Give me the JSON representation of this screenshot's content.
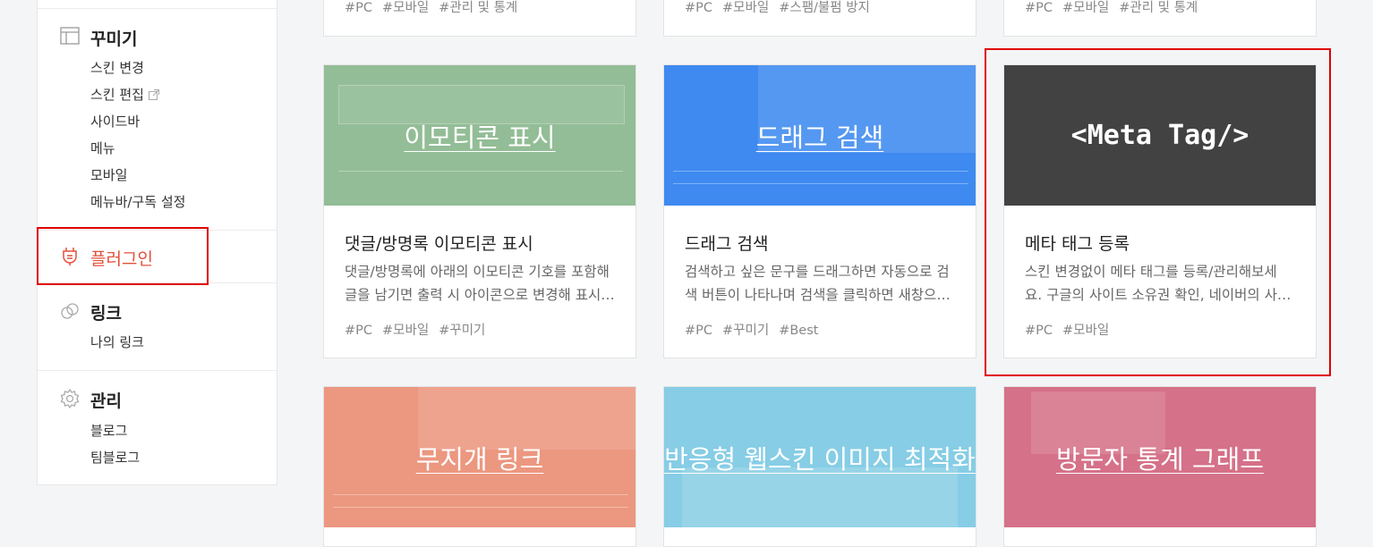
{
  "sidebar": {
    "decorate": {
      "title": "꾸미기",
      "items": [
        "스킨 변경",
        "스킨 편집",
        "사이드바",
        "메뉴",
        "모바일",
        "메뉴바/구독 설정"
      ]
    },
    "plugin": {
      "title": "플러그인"
    },
    "link": {
      "title": "링크",
      "items": [
        "나의 링크"
      ]
    },
    "manage": {
      "title": "관리",
      "items": [
        "블로그",
        "팀블로그"
      ]
    }
  },
  "top_tags": [
    [
      "#PC",
      "#모바일",
      "#관리 및 통계"
    ],
    [
      "#PC",
      "#모바일",
      "#스팸/불펌 방지"
    ],
    [
      "#PC",
      "#모바일",
      "#관리 및 통계"
    ]
  ],
  "cards": [
    {
      "thumb_text": "이모티콘 표시",
      "thumb_color": "#93bd96",
      "title": "댓글/방명록 이모티콘 표시",
      "desc": [
        "댓글/방명록에 아래의 이모티콘 기호를 포함해",
        "글을 남기면 출력 시 아이콘으로 변경해 표시…"
      ],
      "tags": [
        "#PC",
        "#모바일",
        "#꾸미기"
      ]
    },
    {
      "thumb_text": "드래그 검색",
      "thumb_color": "#3e8af0",
      "title": "드래그 검색",
      "desc": [
        "검색하고 싶은 문구를 드래그하면 자동으로 검",
        "색 버튼이 나타나며 검색을 클릭하면 새창으…"
      ],
      "tags": [
        "#PC",
        "#꾸미기",
        "#Best"
      ]
    },
    {
      "thumb_text": "<Meta Tag/>",
      "thumb_color": "#424242",
      "title": "메타 태그 등록",
      "desc": [
        "스킨 변경없이 메타 태그를 등록/관리해보세",
        "요. 구글의 사이트 소유권 확인, 네이버의 사…"
      ],
      "tags": [
        "#PC",
        "#모바일"
      ]
    },
    {
      "thumb_text": "무지개 링크",
      "thumb_color": "#ec9780"
    },
    {
      "thumb_text": "반응형 웹스킨 이미지 최적화",
      "thumb_color": "#86cde5"
    },
    {
      "thumb_text": "방문자 통계 그래프",
      "thumb_color": "#d57188"
    }
  ],
  "colors": {
    "highlight": "#e00000",
    "plugin_accent": "#e2513b"
  }
}
